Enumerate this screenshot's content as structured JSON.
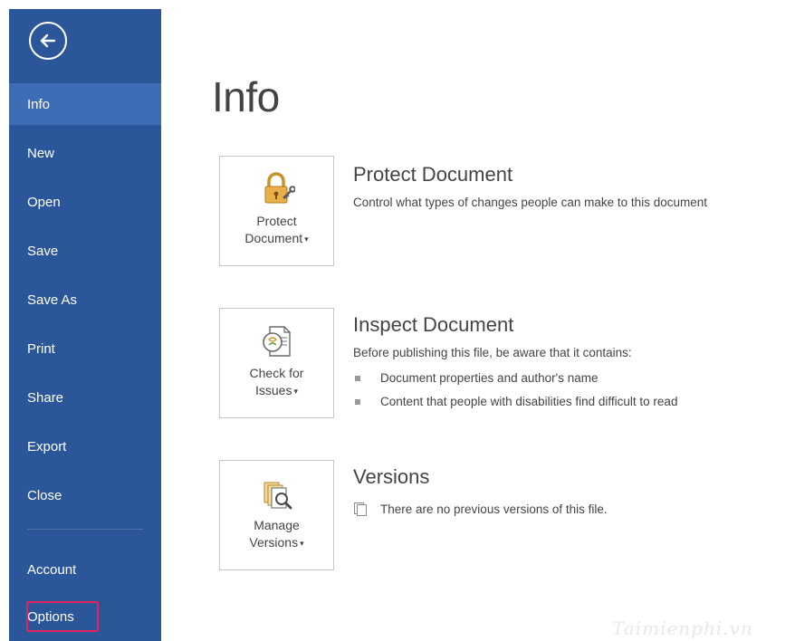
{
  "sidebar": {
    "back_icon": "back-arrow-icon",
    "items": [
      {
        "id": "info",
        "label": "Info",
        "active": true
      },
      {
        "id": "new",
        "label": "New"
      },
      {
        "id": "open",
        "label": "Open"
      },
      {
        "id": "save",
        "label": "Save"
      },
      {
        "id": "save-as",
        "label": "Save As"
      },
      {
        "id": "print",
        "label": "Print"
      },
      {
        "id": "share",
        "label": "Share"
      },
      {
        "id": "export",
        "label": "Export"
      },
      {
        "id": "close",
        "label": "Close"
      }
    ],
    "bottom_items": [
      {
        "id": "account",
        "label": "Account"
      },
      {
        "id": "options",
        "label": "Options",
        "highlighted": true
      }
    ],
    "bg_color": "#2b579a",
    "active_color": "#3e6db5",
    "highlight_color": "#e0245e"
  },
  "main": {
    "title": "Info",
    "sections": [
      {
        "id": "protect",
        "button": {
          "line1": "Protect",
          "line2": "Document",
          "icon": "lock-key-icon"
        },
        "title": "Protect Document",
        "description": "Control what types of changes people can make to this document"
      },
      {
        "id": "inspect",
        "button": {
          "line1": "Check for",
          "line2": "Issues",
          "icon": "inspect-document-icon"
        },
        "title": "Inspect Document",
        "description": "Before publishing this file, be aware that it contains:",
        "bullets": [
          "Document properties and author's name",
          "Content that people with disabilities find difficult to read"
        ]
      },
      {
        "id": "versions",
        "button": {
          "line1": "Manage",
          "line2": "Versions",
          "icon": "manage-versions-icon"
        },
        "title": "Versions",
        "description": "There are no previous versions of this file.",
        "description_icon": "document-versions-icon"
      }
    ]
  },
  "watermark": "Taimienphi.vn"
}
